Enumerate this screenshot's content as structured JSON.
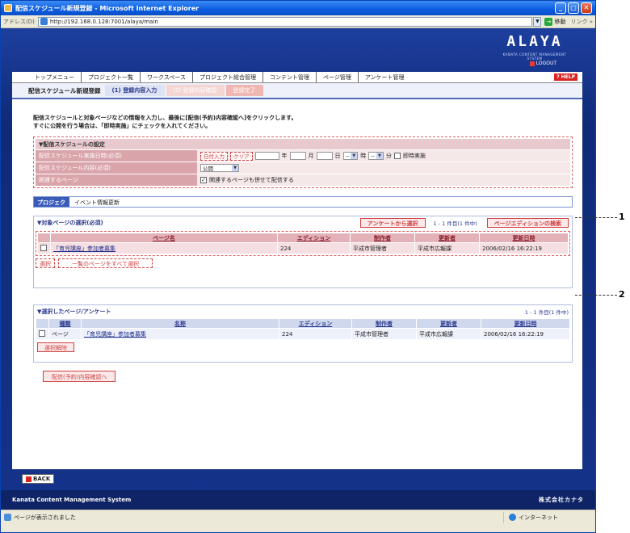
{
  "window": {
    "title": "配信スケジュール新規登録 - Microsoft Internet Explorer",
    "address_label": "アドレス(D)",
    "url": "http://192.168.0.128:7001/alaya/main",
    "go_label": "移動",
    "links_label": "リンク"
  },
  "brand": {
    "logo": "ALAYA",
    "tagline": "KANATA CONTENT MANAGEMENT SYSTEM",
    "logout": "LOGOUT"
  },
  "nav": {
    "tabs": [
      "トップメニュー",
      "プロジェクト一覧",
      "ワークスペース",
      "プロジェクト総合管理",
      "コンテント管理",
      "ページ管理",
      "アンケート管理"
    ],
    "help": "HELP"
  },
  "steps": {
    "current": "配信スケジュール新規登録",
    "items": [
      "(1) 登録内容入力",
      "(2) 登録内容確認",
      "登録完了"
    ]
  },
  "instructions": {
    "line1": "配信スケジュールと対象ページなどの情報を入力し、最後に[配信(予約)内容確認へ]をクリックします。",
    "line2": "すぐに公開を行う場合は、「即時実施」にチェックを入れてください。"
  },
  "schedule": {
    "header": "▼配信スケジュールの設定",
    "date_label": "配信スケジュール実施日時(必須)",
    "date_input_btn": "日付入力",
    "clear_btn": "クリア",
    "year": "年",
    "month": "月",
    "day": "日",
    "hour_sel": "--",
    "hour": "時",
    "min_sel": "--",
    "minute": "分",
    "immediate": "即時実施",
    "content_label": "配信スケジュール内容(必須)",
    "content_value": "公開",
    "related_label": "関連するページ",
    "related_value": "関連するページも併せて配信する"
  },
  "project": {
    "label": "プロジェクト",
    "value": "イベント情報更新"
  },
  "target": {
    "header": "▼対象ページの選択(必須)",
    "survey_btn": "アンケートから選択",
    "count": "1 - 1 件目(1 件中)",
    "search_btn": "ページエディションの検索",
    "columns": [
      "",
      "ページ名",
      "エディション",
      "制作者",
      "更新者",
      "更新日時"
    ],
    "rows": [
      {
        "page": "「育児講座」参加者募集",
        "edition": "224",
        "creator": "平成市管理者",
        "updater": "平成市広報課",
        "updated": "2006/02/16 16:22:19"
      }
    ],
    "select_btn": "選択",
    "select_all_btn": "一覧のページをすべて選択"
  },
  "selected": {
    "header": "▼選択したページ/アンケート",
    "count": "1 - 1 件目(1 件中)",
    "columns": [
      "",
      "種類",
      "名称",
      "エディション",
      "制作者",
      "更新者",
      "更新日時"
    ],
    "rows": [
      {
        "type": "ページ",
        "name": "「育児講座」参加者募集",
        "edition": "224",
        "creator": "平成市管理者",
        "updater": "平成市広報課",
        "updated": "2006/02/16 16:22:19"
      }
    ],
    "deselect_btn": "選択解除"
  },
  "confirm_btn": "配信(予約)内容確認へ",
  "back_btn": "BACK",
  "footer": {
    "left": "Kanata Content Management System",
    "right": "株式会社カナタ"
  },
  "status": {
    "text": "ページが表示されました",
    "zone": "インターネット"
  },
  "callouts": [
    "1",
    "2"
  ]
}
